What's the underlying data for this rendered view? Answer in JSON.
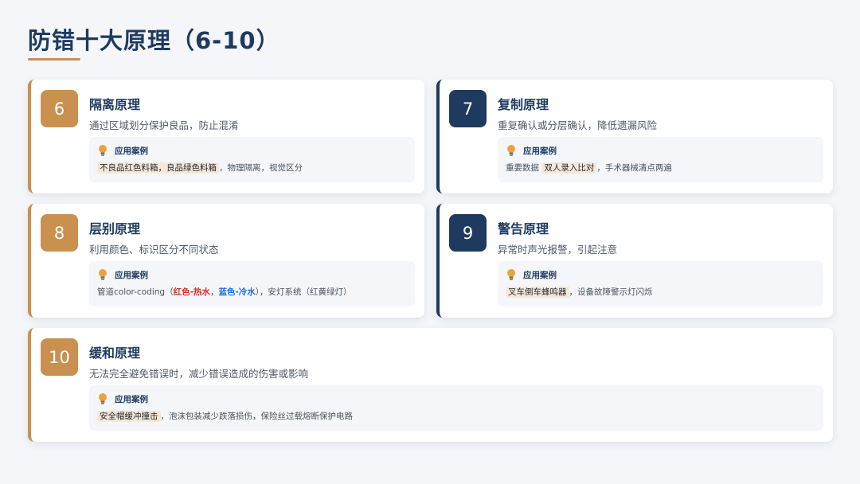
{
  "page": {
    "title": "防错十大原理（6-10）"
  },
  "colors": {
    "accent_gold": "#c9904f",
    "accent_navy": "#1e3a5f",
    "red_text": "#d63031",
    "blue_text": "#1e6fd9"
  },
  "case_label": "应用案例",
  "case_icon": "lightbulb-icon",
  "cards": [
    {
      "number": "6",
      "title": "隔离原理",
      "desc": "通过区域划分保护良品，防止混淆",
      "case": {
        "hl1": "不良品红色料箱，良品绿色料箱",
        "rest": "，物理隔离，视觉区分"
      }
    },
    {
      "number": "7",
      "title": "复制原理",
      "desc": "重复确认或分层确认，降低遗漏风险",
      "case": {
        "prefix": "重要数据 ",
        "hl1": "双人录入比对",
        "rest": "，手术器械清点两遍"
      }
    },
    {
      "number": "8",
      "title": "层别原理",
      "desc": "利用颜色、标识区分不同状态",
      "case": {
        "prefix": "管道color-coding（",
        "red": "红色-热水",
        "sep": "，",
        "blue": "蓝色-冷水",
        "rest": "），安灯系统（红黄绿灯）"
      }
    },
    {
      "number": "9",
      "title": "警告原理",
      "desc": "异常时声光报警，引起注意",
      "case": {
        "hl1": "叉车倒车蜂鸣器",
        "rest": "，设备故障警示灯闪烁"
      }
    },
    {
      "number": "10",
      "title": "缓和原理",
      "desc": "无法完全避免错误时，减少错误造成的伤害或影响",
      "case": {
        "hl1": "安全帽缓冲撞击",
        "rest": "，泡沫包装减少跌落损伤，保险丝过载熔断保护电路"
      }
    }
  ]
}
